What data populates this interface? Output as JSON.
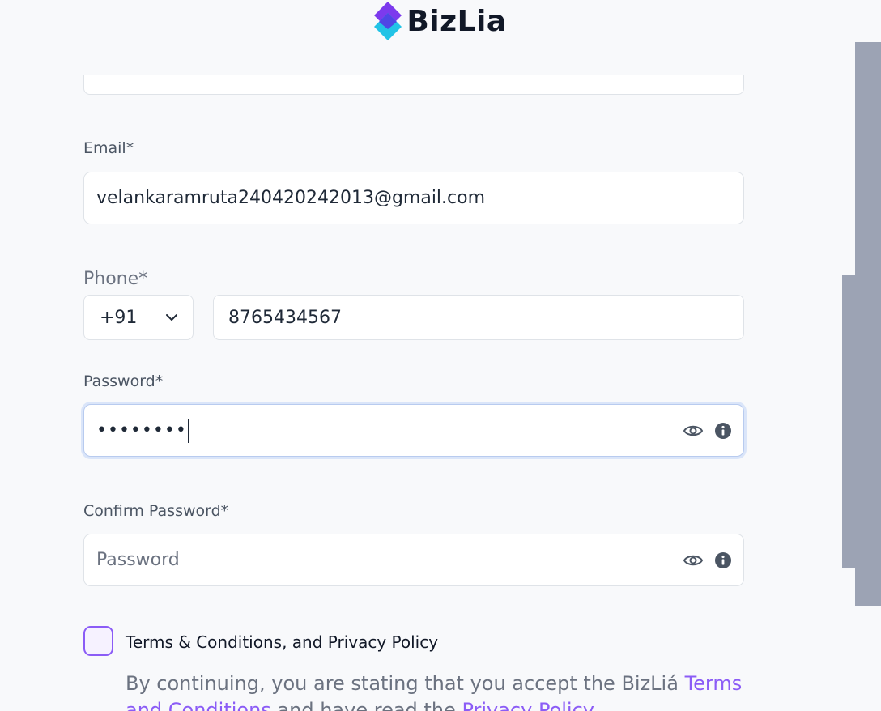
{
  "brand": {
    "name": "BizLia",
    "logo_icon": "diamond-logo-icon"
  },
  "form": {
    "email": {
      "label": "Email*",
      "value": "velankaramruta240420242013@gmail.com"
    },
    "phone": {
      "label": "Phone*",
      "country_code": "+91",
      "number": "8765434567"
    },
    "password": {
      "label": "Password*",
      "masked_value": "••••••••"
    },
    "confirm_password": {
      "label": "Confirm Password*",
      "placeholder": "Password"
    },
    "terms": {
      "checkbox_label": "Terms & Conditions, and Privacy Policy",
      "checked": false,
      "disclaimer_prefix": "By continuing, you are stating that you accept the BizLiá ",
      "terms_link": "Terms and Conditions",
      "disclaimer_middle": " and have read the ",
      "privacy_link": "Privacy Policy"
    }
  },
  "colors": {
    "accent": "#8b5cf6",
    "focus_ring": "#c1d5f7",
    "scrollbar": "#9ca3b4"
  }
}
